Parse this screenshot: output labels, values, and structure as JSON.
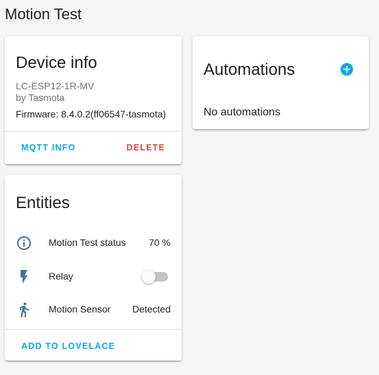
{
  "page": {
    "title": "Motion Test"
  },
  "device_card": {
    "title": "Device info",
    "model": "LC-ESP12-1R-MV",
    "manufacturer": "by Tasmota",
    "firmware": "Firmware: 8.4.0.2(ff06547-tasmota)",
    "mqtt_info_label": "MQTT INFO",
    "delete_label": "DELETE"
  },
  "entities_card": {
    "title": "Entities",
    "items": [
      {
        "icon": "info-circle-icon",
        "name": "Motion Test status",
        "state": "70 %"
      },
      {
        "icon": "flash-icon",
        "name": "Relay",
        "state_type": "toggle",
        "toggle_on": false
      },
      {
        "icon": "walk-icon",
        "name": "Motion Sensor",
        "state": "Detected"
      }
    ],
    "add_label": "ADD TO LOVELACE"
  },
  "automations_card": {
    "title": "Automations",
    "add_icon": "plus-circle-icon",
    "empty_text": "No automations"
  },
  "colors": {
    "primary": "#03a9f4",
    "delete": "#db4437",
    "icon": "#44739e",
    "secondary_text": "#727272"
  }
}
